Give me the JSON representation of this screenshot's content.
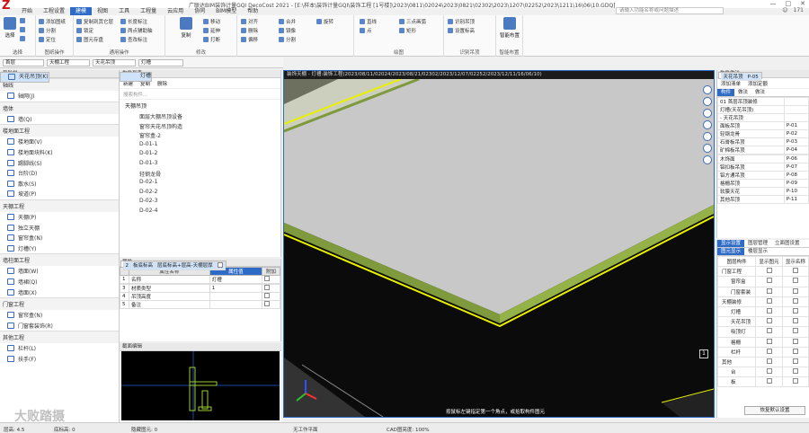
{
  "app": {
    "title": "广联达BIM装饰计量GQI DecoCost 2021 - [E:\\样本\\装饰计量GQI\\装饰工程 [1号楼]\\2023\\0811\\02024\\2023\\0821\\02302\\2023\\1207\\02252\\2023\\1211\\16\\06\\10.GDQ]",
    "logo": "Z",
    "window_controls": [
      "—",
      "□",
      "✕"
    ],
    "search_placeholder": "请输入功能名称或问题描述",
    "user_count": "171"
  },
  "menu": [
    "开始",
    "工程设置",
    "建模",
    "视图",
    "工具",
    "工程量",
    "云应用",
    "协同",
    "BIM模型",
    "帮助"
  ],
  "menu_active": 2,
  "ribbon": {
    "groups": [
      "选择",
      "图纸操作",
      "通用操作",
      "修改",
      "绘图",
      "识别吊顶",
      "设置",
      "智能布置"
    ],
    "select": {
      "big": "选择",
      "items": [
        "点",
        "查找图元",
        "过滤图元"
      ]
    },
    "drawing": {
      "items": [
        "添加图纸",
        "分割",
        "定位",
        "删除",
        "查找替换",
        "还原CAD"
      ]
    },
    "common": {
      "items": [
        "复制到其它层",
        "锁定",
        "图元存盘",
        "长度标注",
        "两点辅助轴",
        "查改标注"
      ]
    },
    "modify": {
      "items": [
        "复制",
        "移动",
        "延伸",
        "打断",
        "对齐",
        "删除",
        "偏移",
        "合并",
        "镜像",
        "分割",
        "旋转"
      ]
    },
    "draw": {
      "items": [
        "直线",
        "点",
        "三点画弧",
        "矩形",
        "智能布置"
      ]
    },
    "recog": {
      "items": [
        "识别吊顶",
        "设置标高"
      ]
    },
    "smart": {
      "big": "智能布置"
    }
  },
  "selectbar": {
    "floor": "首层",
    "category": "天棚工程",
    "type": "天花吊顶",
    "component": "灯槽"
  },
  "left_nav": {
    "header": "导航栏",
    "sections": [
      {
        "title": "轴线",
        "items": [
          "轴网(J)"
        ]
      },
      {
        "title": "墙体",
        "items": [
          "墙(Q)"
        ]
      },
      {
        "title": "楼地面工程",
        "items": [
          "楼地面(V)",
          "楼地面块料(K)",
          "踢脚线(S)",
          "台阶(D)",
          "散水(S)",
          "坡道(P)"
        ]
      },
      {
        "title": "天棚工程",
        "items": [
          "天棚(P)",
          "天花吊顶(K)",
          "独立天棚",
          "窗帘盒(N)",
          "灯槽(Y)"
        ]
      },
      {
        "title": "墙柱面工程",
        "items": [
          "墙面(W)",
          "墙裙(Q)",
          "墙面(X)"
        ]
      },
      {
        "title": "门窗工程",
        "items": [
          "窗帘盒(N)",
          "门窗套装饰(R)"
        ]
      },
      {
        "title": "其他工程",
        "items": [
          "栏杆(L)",
          "扶手(F)"
        ]
      }
    ],
    "selected": "天花吊顶(K)"
  },
  "component_list": {
    "header": "构件列表",
    "toolbar": [
      "新建",
      "复制",
      "删除"
    ],
    "search_placeholder": "搜索构件...",
    "root": "天棚吊顶",
    "items": [
      "面层大棚吊顶设备",
      "灯槽",
      "窗帘天花吊顶构造",
      "窗帘盒-2",
      "D-01-1",
      "D-01-2",
      "D-01-3",
      "轻钢龙骨",
      "D-02-1",
      "D-02-2",
      "D-02-3",
      "D-02-4"
    ],
    "selected": "灯槽"
  },
  "properties": {
    "header": "属性",
    "columns": [
      "属性名称",
      "属性值",
      "附加"
    ],
    "rows": [
      {
        "num": "1",
        "name": "名称",
        "value": "灯槽"
      },
      {
        "num": "2",
        "name": "板底标高",
        "value": "层底标高+层高-天棚层厚"
      },
      {
        "num": "3",
        "name": "材质类型",
        "value": "1"
      },
      {
        "num": "4",
        "name": "吊顶高度",
        "value": ""
      },
      {
        "num": "5",
        "name": "备注",
        "value": ""
      }
    ]
  },
  "thumbnail": {
    "header": "截面编辑"
  },
  "viewport": {
    "title": "装饰天棚 - 灯槽:装饰工程(2023/08/11/02024/2023/08/21/02302/2023/12/07/02252/2023/12/11/16/06/10)",
    "hint": "按鼠标左键指定第一个角点，或拾取构件图元",
    "corner_icon": "1"
  },
  "components_panel": {
    "header": "构件做法",
    "toolbar": [
      "添加清单",
      "添加定额",
      "查询"
    ],
    "tabs": [
      "构件",
      "做法",
      "做法"
    ],
    "tree": [
      {
        "name": "01 首层吊顶装修",
        "code": ""
      },
      {
        "name": "灯槽(天花吊顶)",
        "code": ""
      },
      {
        "name": "- 天花吊顶",
        "code": ""
      },
      {
        "name": "面板吊顶",
        "code": "P-01"
      },
      {
        "name": "轻钢龙骨",
        "code": "P-02"
      },
      {
        "name": "石膏板吊顶",
        "code": "P-03"
      },
      {
        "name": "矿棉板吊顶",
        "code": "P-04"
      },
      {
        "name": "天花吊顶",
        "code": "P-05"
      },
      {
        "name": "木饰面",
        "code": "P-06"
      },
      {
        "name": "铝扣板吊顶",
        "code": "P-07"
      },
      {
        "name": "铝方通吊顶",
        "code": "P-08"
      },
      {
        "name": "格栅吊顶",
        "code": "P-09"
      },
      {
        "name": "软膜天花",
        "code": "P-10"
      },
      {
        "name": "其他吊顶",
        "code": "P-11"
      }
    ],
    "selected": "天花吊顶"
  },
  "display_panel": {
    "tabs": [
      "显示设置",
      "图层管理",
      "立面图设置"
    ],
    "subtabs": [
      "图元显示",
      "楼层显示"
    ],
    "columns": [
      "图层构件",
      "显示图元",
      "显示名称"
    ],
    "rows": [
      {
        "name": "门窗工程",
        "indent": 0
      },
      {
        "name": "窗帘盒",
        "indent": 1
      },
      {
        "name": "门窗套装",
        "indent": 1
      },
      {
        "name": "天棚装修",
        "indent": 0
      },
      {
        "name": "灯槽",
        "indent": 1
      },
      {
        "name": "天花吊顶",
        "indent": 1
      },
      {
        "name": "吸顶灯",
        "indent": 1
      },
      {
        "name": "格栅",
        "indent": 1
      },
      {
        "name": "栏杆",
        "indent": 1
      },
      {
        "name": "其他",
        "indent": 0
      },
      {
        "name": "台",
        "indent": 1
      },
      {
        "name": "板",
        "indent": 1
      }
    ],
    "reset_button": "恢复默认设置"
  },
  "statusbar": {
    "floor_height": "层高: 4.5",
    "floor_bottom": "底标高: 0",
    "rows_label": "0",
    "hidden": "隐藏图元: 0",
    "mode": "无工作平面",
    "cad": "CAD图亮度: 100%",
    "watermark": "大败踏摄"
  }
}
